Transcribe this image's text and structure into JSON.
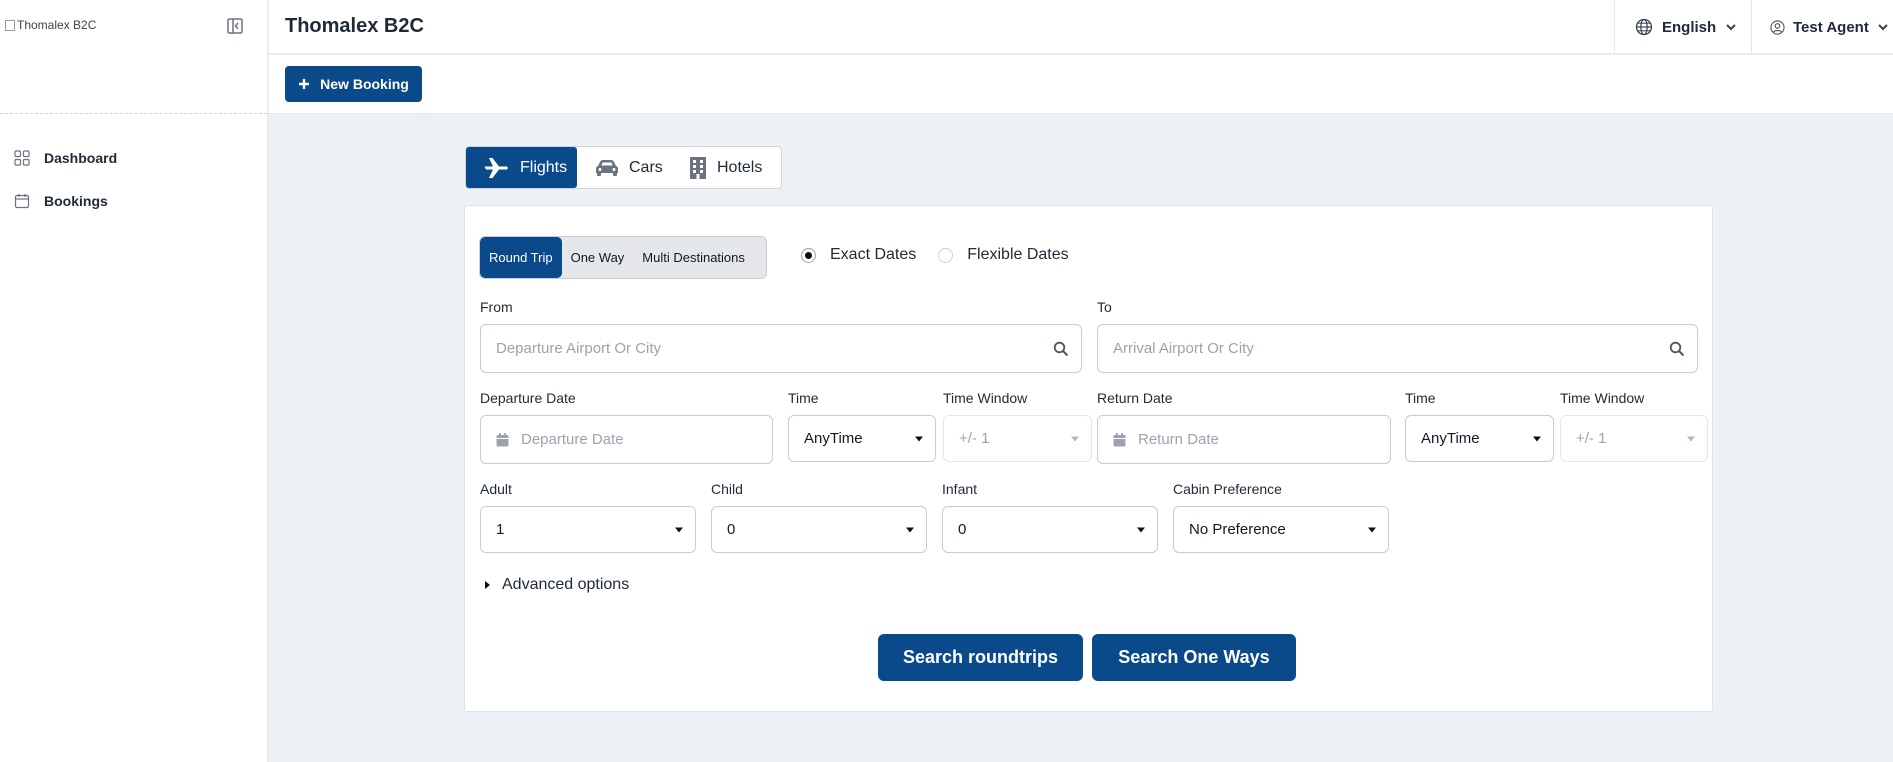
{
  "brand": {
    "logo_alt": "Thomalex B2C",
    "app_title": "Thomalex B2C"
  },
  "sidebar": {
    "items": [
      {
        "label": "Dashboard",
        "icon": "grid-icon"
      },
      {
        "label": "Bookings",
        "icon": "calendar-icon"
      }
    ]
  },
  "header": {
    "language": "English",
    "user": "Test Agent"
  },
  "toolbar": {
    "new_booking": "New Booking"
  },
  "services": {
    "tabs": [
      {
        "label": "Flights",
        "active": true
      },
      {
        "label": "Cars"
      },
      {
        "label": "Hotels"
      }
    ]
  },
  "trip_type": {
    "options": [
      "Round Trip",
      "One Way",
      "Multi Destinations"
    ],
    "selected": "Round Trip"
  },
  "date_mode": {
    "exact": "Exact Dates",
    "flexible": "Flexible Dates",
    "selected": "Exact Dates"
  },
  "form": {
    "from_label": "From",
    "from_placeholder": "Departure Airport Or City",
    "to_label": "To",
    "to_placeholder": "Arrival Airport Or City",
    "departure_date_label": "Departure Date",
    "departure_date_placeholder": "Departure Date",
    "time_label": "Time",
    "time_value": "AnyTime",
    "time_window_label": "Time Window",
    "time_window_value": "+/- 1",
    "return_date_label": "Return Date",
    "return_date_placeholder": "Return Date",
    "return_time_label": "Time",
    "return_time_value": "AnyTime",
    "return_time_window_label": "Time Window",
    "return_time_window_value": "+/- 1",
    "adult_label": "Adult",
    "adult_value": "1",
    "child_label": "Child",
    "child_value": "0",
    "infant_label": "Infant",
    "infant_value": "0",
    "cabin_label": "Cabin Preference",
    "cabin_value": "No Preference",
    "advanced": "Advanced options"
  },
  "actions": {
    "search_roundtrips": "Search roundtrips",
    "search_one_ways": "Search One Ways"
  },
  "colors": {
    "primary": "#0a4a8a",
    "background": "#edf1f5"
  }
}
